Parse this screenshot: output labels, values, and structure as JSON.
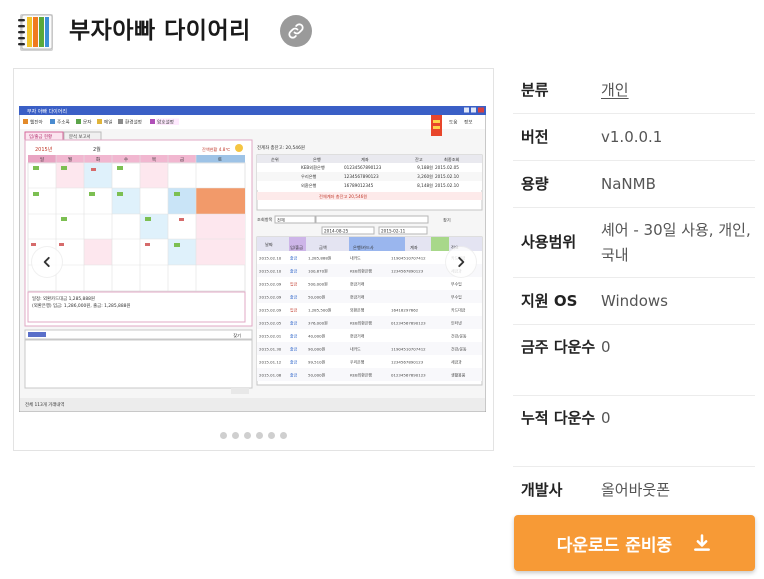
{
  "app": {
    "title": "부자아빠 다이어리",
    "link_icon": "link-icon",
    "app_icon": "notebook-icon"
  },
  "screenshot": {
    "window_title": "부자 아빠 다이어리",
    "toolbar": [
      "웹진아",
      "주소록",
      "문자",
      "메일",
      "환경설정",
      "암호설정"
    ],
    "right_toolbar": [
      "도움",
      "정보"
    ],
    "tabs": [
      "입/출금 현황",
      "분석 보고서"
    ],
    "calendar": {
      "year": "2015년",
      "month": "2월",
      "balance": "잔액현황 4.8℃",
      "weekdays": [
        "일",
        "월",
        "화",
        "수",
        "목",
        "금",
        "토"
      ],
      "summary": [
        "일정: 외환카드대금 1,285,888원",
        "(외환은행) 입금: 1,286,000원, 출금: 1,285,888원"
      ]
    },
    "accounts": {
      "header": "전계좌 총잔고: 20,546원",
      "columns": [
        "순위",
        "은행",
        "계좌",
        "잔고",
        "최종조회"
      ],
      "rows": [
        [
          "KEB외환은행",
          "01234567890123",
          "9,188원",
          "2015.02.05"
        ],
        [
          "우리은행",
          "1234567890123",
          "3,260원",
          "2015.02.10"
        ],
        [
          "외환은행",
          "16789012345",
          "8,148원",
          "2015.02.10"
        ]
      ],
      "total": "전체계좌 총잔고 20,546원"
    },
    "search": {
      "label": "조회항목",
      "option": "전체",
      "find": "찾기",
      "date_from": "2014-08-25",
      "date_to": "2015-02-11"
    },
    "transactions": {
      "columns": [
        "날짜",
        "입/출금",
        "금액",
        "은행/카드사",
        "계좌",
        "적요"
      ],
      "rows": [
        [
          "2015.02.10",
          "출금",
          "1,285,888원",
          "내카드",
          "11904510707412",
          "카드대금"
        ],
        [
          "2015.02.10",
          "출금",
          "100,870원",
          "KEB외환은행",
          "1234567890123",
          "세금과"
        ],
        [
          "2015.02.09",
          "입금",
          "500,000원",
          "현금거래",
          "",
          "부수입"
        ],
        [
          "2015.02.09",
          "출금",
          "50,000원",
          "현금거래",
          "",
          "부수입"
        ],
        [
          "2015.02.09",
          "입금",
          "1,285,500원",
          "외환은행",
          "16418297662",
          "카드대금"
        ],
        [
          "2015.02.05",
          "출금",
          "376,000원",
          "KEB외환은행",
          "01234567890123",
          "인터넷"
        ],
        [
          "2015.02.01",
          "출금",
          "40,000원",
          "현금거래",
          "",
          "건강/운동"
        ],
        [
          "2015.01.30",
          "출금",
          "90,000원",
          "내카드",
          "11904510707412",
          "건강/운동"
        ],
        [
          "2015.01.12",
          "출금",
          "99,510원",
          "우리은행",
          "1234567890123",
          "세금과"
        ],
        [
          "2015.01.08",
          "출금",
          "50,000원",
          "KEB외환은행",
          "01234567890123",
          "생활용품"
        ]
      ]
    },
    "memo_find": "찾기",
    "status": "전체 113개 거래내역"
  },
  "carousel": {
    "dot_count": 6,
    "prev_icon": "chevron-left-icon",
    "next_icon": "chevron-right-icon"
  },
  "info": {
    "rows": [
      {
        "label": "분류",
        "value": "개인",
        "link": true
      },
      {
        "label": "버전",
        "value": "v1.0.0.1"
      },
      {
        "label": "용량",
        "value": "NaNMB"
      },
      {
        "label": "사용범위",
        "value": "셰어 - 30일 사용, 개인, 국내"
      },
      {
        "label": "지원 OS",
        "value": "Windows"
      },
      {
        "label": "금주 다운수",
        "value": "0"
      },
      {
        "label": "누적 다운수",
        "value": "0"
      },
      {
        "label": "개발사",
        "value": "올어바웃폰"
      }
    ]
  },
  "download": {
    "label": "다운로드 준비중",
    "icon": "download-icon",
    "color": "#f79a36"
  }
}
